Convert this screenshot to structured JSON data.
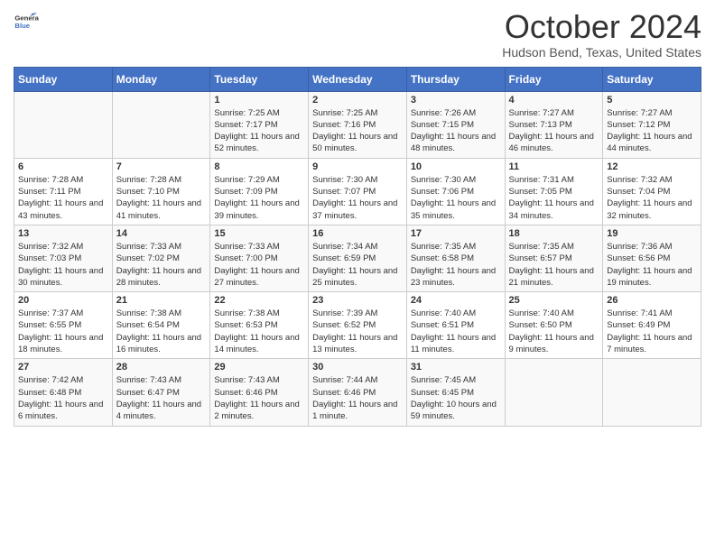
{
  "header": {
    "logo_line1": "General",
    "logo_line2": "Blue",
    "month": "October 2024",
    "location": "Hudson Bend, Texas, United States"
  },
  "days_of_week": [
    "Sunday",
    "Monday",
    "Tuesday",
    "Wednesday",
    "Thursday",
    "Friday",
    "Saturday"
  ],
  "weeks": [
    [
      {
        "day": "",
        "content": ""
      },
      {
        "day": "",
        "content": ""
      },
      {
        "day": "1",
        "content": "Sunrise: 7:25 AM\nSunset: 7:17 PM\nDaylight: 11 hours and 52 minutes."
      },
      {
        "day": "2",
        "content": "Sunrise: 7:25 AM\nSunset: 7:16 PM\nDaylight: 11 hours and 50 minutes."
      },
      {
        "day": "3",
        "content": "Sunrise: 7:26 AM\nSunset: 7:15 PM\nDaylight: 11 hours and 48 minutes."
      },
      {
        "day": "4",
        "content": "Sunrise: 7:27 AM\nSunset: 7:13 PM\nDaylight: 11 hours and 46 minutes."
      },
      {
        "day": "5",
        "content": "Sunrise: 7:27 AM\nSunset: 7:12 PM\nDaylight: 11 hours and 44 minutes."
      }
    ],
    [
      {
        "day": "6",
        "content": "Sunrise: 7:28 AM\nSunset: 7:11 PM\nDaylight: 11 hours and 43 minutes."
      },
      {
        "day": "7",
        "content": "Sunrise: 7:28 AM\nSunset: 7:10 PM\nDaylight: 11 hours and 41 minutes."
      },
      {
        "day": "8",
        "content": "Sunrise: 7:29 AM\nSunset: 7:09 PM\nDaylight: 11 hours and 39 minutes."
      },
      {
        "day": "9",
        "content": "Sunrise: 7:30 AM\nSunset: 7:07 PM\nDaylight: 11 hours and 37 minutes."
      },
      {
        "day": "10",
        "content": "Sunrise: 7:30 AM\nSunset: 7:06 PM\nDaylight: 11 hours and 35 minutes."
      },
      {
        "day": "11",
        "content": "Sunrise: 7:31 AM\nSunset: 7:05 PM\nDaylight: 11 hours and 34 minutes."
      },
      {
        "day": "12",
        "content": "Sunrise: 7:32 AM\nSunset: 7:04 PM\nDaylight: 11 hours and 32 minutes."
      }
    ],
    [
      {
        "day": "13",
        "content": "Sunrise: 7:32 AM\nSunset: 7:03 PM\nDaylight: 11 hours and 30 minutes."
      },
      {
        "day": "14",
        "content": "Sunrise: 7:33 AM\nSunset: 7:02 PM\nDaylight: 11 hours and 28 minutes."
      },
      {
        "day": "15",
        "content": "Sunrise: 7:33 AM\nSunset: 7:00 PM\nDaylight: 11 hours and 27 minutes."
      },
      {
        "day": "16",
        "content": "Sunrise: 7:34 AM\nSunset: 6:59 PM\nDaylight: 11 hours and 25 minutes."
      },
      {
        "day": "17",
        "content": "Sunrise: 7:35 AM\nSunset: 6:58 PM\nDaylight: 11 hours and 23 minutes."
      },
      {
        "day": "18",
        "content": "Sunrise: 7:35 AM\nSunset: 6:57 PM\nDaylight: 11 hours and 21 minutes."
      },
      {
        "day": "19",
        "content": "Sunrise: 7:36 AM\nSunset: 6:56 PM\nDaylight: 11 hours and 19 minutes."
      }
    ],
    [
      {
        "day": "20",
        "content": "Sunrise: 7:37 AM\nSunset: 6:55 PM\nDaylight: 11 hours and 18 minutes."
      },
      {
        "day": "21",
        "content": "Sunrise: 7:38 AM\nSunset: 6:54 PM\nDaylight: 11 hours and 16 minutes."
      },
      {
        "day": "22",
        "content": "Sunrise: 7:38 AM\nSunset: 6:53 PM\nDaylight: 11 hours and 14 minutes."
      },
      {
        "day": "23",
        "content": "Sunrise: 7:39 AM\nSunset: 6:52 PM\nDaylight: 11 hours and 13 minutes."
      },
      {
        "day": "24",
        "content": "Sunrise: 7:40 AM\nSunset: 6:51 PM\nDaylight: 11 hours and 11 minutes."
      },
      {
        "day": "25",
        "content": "Sunrise: 7:40 AM\nSunset: 6:50 PM\nDaylight: 11 hours and 9 minutes."
      },
      {
        "day": "26",
        "content": "Sunrise: 7:41 AM\nSunset: 6:49 PM\nDaylight: 11 hours and 7 minutes."
      }
    ],
    [
      {
        "day": "27",
        "content": "Sunrise: 7:42 AM\nSunset: 6:48 PM\nDaylight: 11 hours and 6 minutes."
      },
      {
        "day": "28",
        "content": "Sunrise: 7:43 AM\nSunset: 6:47 PM\nDaylight: 11 hours and 4 minutes."
      },
      {
        "day": "29",
        "content": "Sunrise: 7:43 AM\nSunset: 6:46 PM\nDaylight: 11 hours and 2 minutes."
      },
      {
        "day": "30",
        "content": "Sunrise: 7:44 AM\nSunset: 6:46 PM\nDaylight: 11 hours and 1 minute."
      },
      {
        "day": "31",
        "content": "Sunrise: 7:45 AM\nSunset: 6:45 PM\nDaylight: 10 hours and 59 minutes."
      },
      {
        "day": "",
        "content": ""
      },
      {
        "day": "",
        "content": ""
      }
    ]
  ]
}
